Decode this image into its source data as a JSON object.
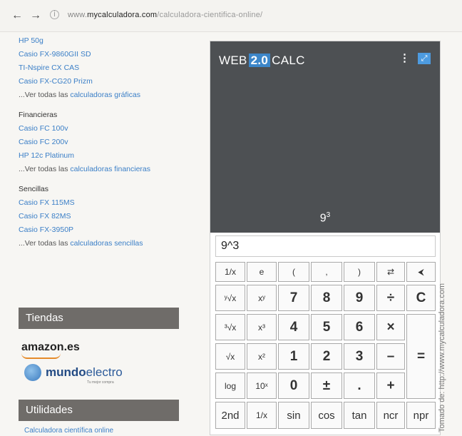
{
  "browser": {
    "back_icon": "←",
    "forward_icon": "→",
    "info_icon": "i",
    "url_prefix": "www.",
    "url_domain": "mycalculadora.com",
    "url_path": "/calculadora-cientifica-online/"
  },
  "sidebar": {
    "graficas_links": [
      "HP 50g",
      "Casio FX-9860GII SD",
      "TI-Nspire CX CAS",
      "Casio FX-CG20 Prizm"
    ],
    "graficas_more_prefix": "...Ver todas las ",
    "graficas_more_link": "calculadoras gráficas",
    "financieras_heading": "Financieras",
    "financieras_links": [
      "Casio FC 100v",
      "Casio FC 200v",
      "HP 12c Platinum"
    ],
    "financieras_more_prefix": "...Ver todas las ",
    "financieras_more_link": "calculadoras financieras",
    "sencillas_heading": "Sencillas",
    "sencillas_links": [
      "Casio FX 115MS",
      "Casio FX 82MS",
      "Casio FX-3950P"
    ],
    "sencillas_more_prefix": "...Ver todas las ",
    "sencillas_more_link": "calculadoras sencillas",
    "tiendas_title": "Tiendas",
    "amazon_label": "amazon.es",
    "mundo_prefix": "mundo",
    "mundo_suffix": "electro",
    "mundo_slogan": "Tu mejor compra",
    "utilidades_title": "Utilidades",
    "utilidades_link": "Calculadora científica online"
  },
  "calculator": {
    "brand_left": "WEB",
    "brand_version": "2.0",
    "brand_right": "CALC",
    "menu_icon": "⋮",
    "expand_icon": "⤢",
    "result_base": "9",
    "result_exp": "3",
    "input_value": "9^3",
    "keys": {
      "r1": [
        "1/x",
        "e",
        "(",
        ",",
        ")",
        "⇄",
        "⮜"
      ],
      "r2": [
        "ʸ√x",
        "xʸ",
        "7",
        "8",
        "9",
        "÷",
        "C"
      ],
      "r3": [
        "³√x",
        "x³",
        "4",
        "5",
        "6",
        "×"
      ],
      "r4": [
        "√x",
        "x²",
        "1",
        "2",
        "3",
        "–",
        "="
      ],
      "r5": [
        "log",
        "10ˣ",
        "0",
        "±",
        ".",
        "+"
      ],
      "r6": [
        "2nd",
        "1/x",
        "sin",
        "cos",
        "tan",
        "ncr",
        "npr"
      ]
    }
  },
  "credit": "Tomado de: http://www.mycalculadora.com"
}
